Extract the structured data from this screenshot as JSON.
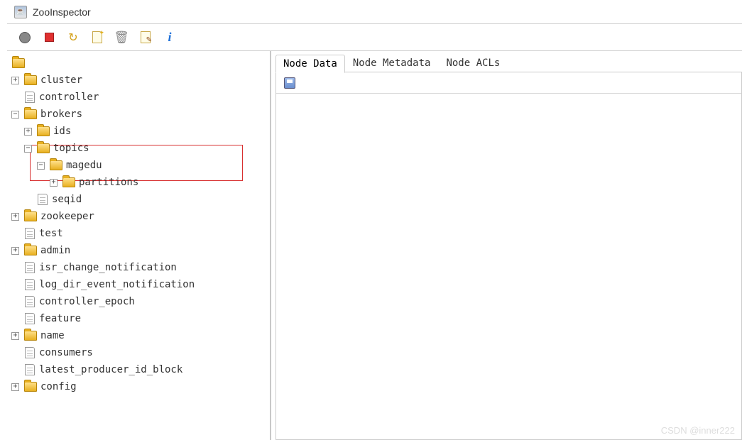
{
  "window": {
    "title": "ZooInspector"
  },
  "toolbar": {
    "connect": "connect",
    "stop": "stop",
    "refresh": "refresh",
    "add": "add-node",
    "delete": "delete-node",
    "edit": "edit-node",
    "info": "about"
  },
  "tree": {
    "root": "/",
    "nodes": {
      "cluster": "cluster",
      "controller": "controller",
      "brokers": "brokers",
      "ids": "ids",
      "topics": "topics",
      "magedu": "magedu",
      "partitions": "partitions",
      "seqid": "seqid",
      "zookeeper": "zookeeper",
      "test": "test",
      "admin": "admin",
      "isr_change_notification": "isr_change_notification",
      "log_dir_event_notification": "log_dir_event_notification",
      "controller_epoch": "controller_epoch",
      "feature": "feature",
      "name": "name",
      "consumers": "consumers",
      "latest_producer_id_block": "latest_producer_id_block",
      "config": "config"
    }
  },
  "tabs": {
    "data": "Node Data",
    "metadata": "Node Metadata",
    "acls": "Node ACLs"
  },
  "watermark": "CSDN @inner222"
}
